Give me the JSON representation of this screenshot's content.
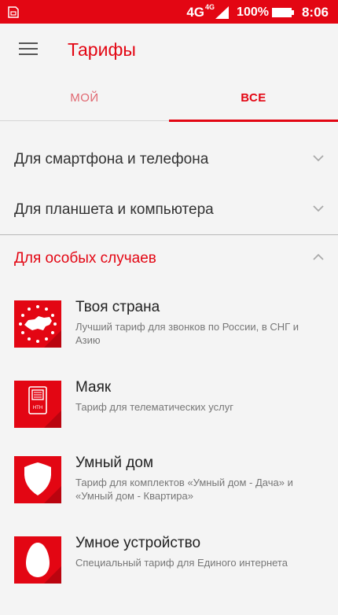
{
  "status_bar": {
    "network": "4G",
    "network_sup": "4G",
    "battery": "100%",
    "time": "8:06"
  },
  "header": {
    "title": "Тарифы"
  },
  "tabs": [
    {
      "label": "МОЙ",
      "active": false
    },
    {
      "label": "ВСЕ",
      "active": true
    }
  ],
  "categories": [
    {
      "label": "Для смартфона и телефона",
      "expanded": false
    },
    {
      "label": "Для планшета и компьютера",
      "expanded": false
    },
    {
      "label": "Для особых случаев",
      "expanded": true
    }
  ],
  "tariffs": [
    {
      "name": "Твоя страна",
      "description": "Лучший тариф для звонков по России, в СНГ и Азию",
      "icon": "russia-map-stars-icon"
    },
    {
      "name": "Маяк",
      "description": "Тариф для телематических услуг",
      "icon": "telematics-device-icon"
    },
    {
      "name": "Умный дом",
      "description": "Тариф для комплектов «Умный дом - Дача» и «Умный дом - Квартира»",
      "icon": "shield-icon"
    },
    {
      "name": "Умное устройство",
      "description": "Специальный тариф для Единого интернета",
      "icon": "egg-icon"
    }
  ],
  "colors": {
    "accent": "#e30613",
    "background": "#f4f4f4",
    "text": "#333333",
    "secondary_text": "#777777"
  }
}
